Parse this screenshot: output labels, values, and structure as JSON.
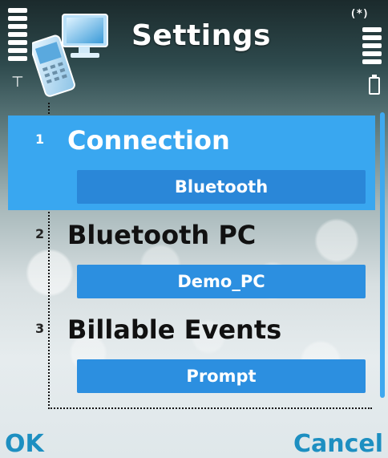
{
  "status": {
    "bluetooth_indicator": "(*)",
    "signal_icon": "signal-strength-icon",
    "battery_icon": "battery-icon"
  },
  "header": {
    "title": "Settings",
    "app_icon": "pc-connectivity-icon"
  },
  "list": {
    "items": [
      {
        "number": "1",
        "label": "Connection",
        "value": "Bluetooth"
      },
      {
        "number": "2",
        "label": "Bluetooth PC",
        "value": "Demo_PC"
      },
      {
        "number": "3",
        "label": "Billable Events",
        "value": "Prompt"
      }
    ],
    "selected_index": 0
  },
  "softkeys": {
    "left": "OK",
    "right": "Cancel"
  },
  "colors": {
    "highlight": "#39a7f0",
    "value_field": "#2c8fe0",
    "softkey_text": "#1d8fc1"
  }
}
